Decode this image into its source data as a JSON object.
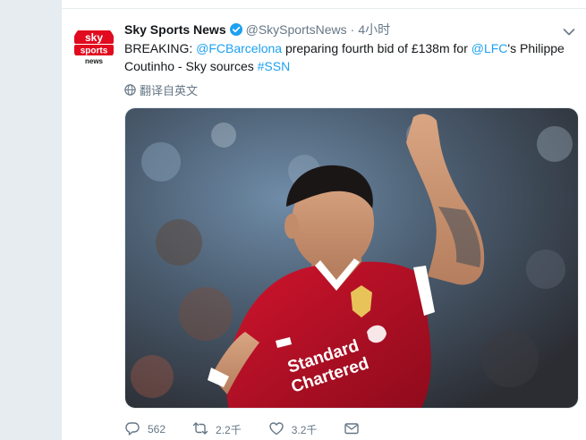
{
  "tweet": {
    "display_name": "Sky Sports News",
    "handle": "@SkySportsNews",
    "separator": "·",
    "timestamp": "4小时",
    "text": {
      "p1": "BREAKING: ",
      "mention1": "@FCBarcelona",
      "p2": " preparing fourth bid of £138m for ",
      "mention2": "@LFC",
      "p3": "'s Philippe Coutinho - Sky sources ",
      "hashtag": "#SSN"
    },
    "translate_label": "翻译自英文",
    "avatar_logo": {
      "line1": "sky",
      "line2": "sports",
      "line3": "news"
    },
    "photo_shirt": {
      "sponsor_line1": "Standard",
      "sponsor_line2": "Chartered"
    }
  },
  "actions": {
    "reply_count": "562",
    "retweet_count": "2.2千",
    "like_count": "3.2千"
  },
  "icons": {
    "verified": "verified-badge-icon",
    "caret": "chevron-down-icon",
    "translate": "globe-icon",
    "reply": "reply-icon",
    "retweet": "retweet-icon",
    "like": "heart-icon",
    "message": "envelope-icon"
  },
  "colors": {
    "link": "#1da1f2",
    "muted": "#657786",
    "sky_red": "#e10a1e",
    "liverpool_red": "#c8102e"
  }
}
